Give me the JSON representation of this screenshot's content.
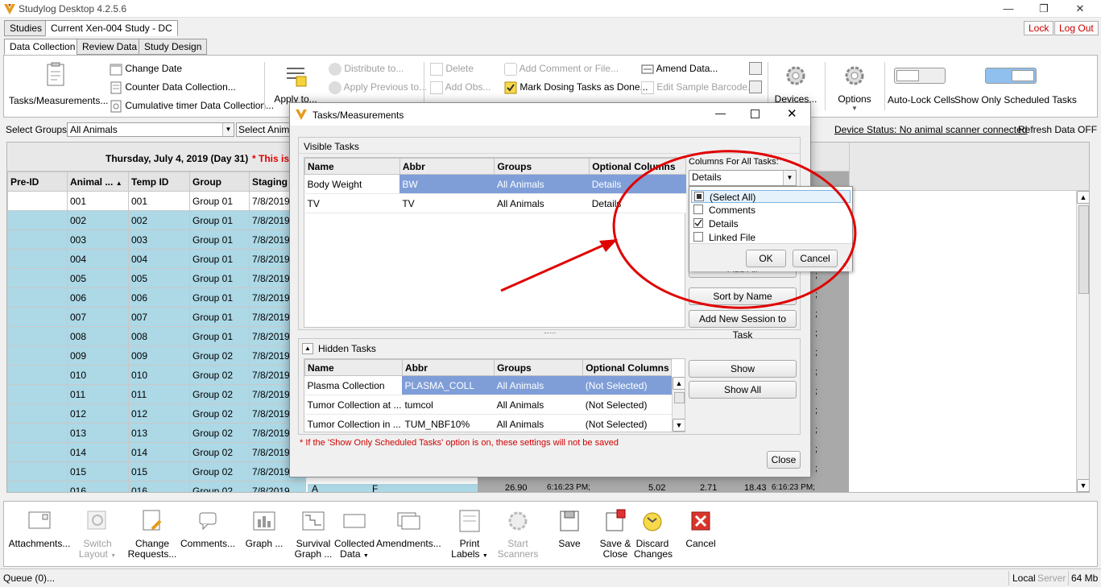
{
  "window": {
    "title": "Studylog Desktop 4.2.5.6"
  },
  "top_tabs": [
    "Studies",
    "Current Xen-004  Study  - DC"
  ],
  "lock_label": "Lock",
  "logout_label": "Log Out",
  "main_tabs": [
    "Data Collection",
    "Review Data",
    "Study Design"
  ],
  "ribbon": {
    "tasks": "Tasks/Measurements...",
    "change_date": "Change Date",
    "counter": "Counter Data Collection...",
    "cumulative": "Cumulative timer Data Collection...",
    "apply_to": "Apply to...",
    "distribute": "Distribute to...",
    "apply_previous": "Apply Previous to...",
    "delete": "Delete",
    "add_obs": "Add Obs...",
    "add_comment": "Add Comment or File...",
    "mark_dosing": "Mark Dosing Tasks as Done...",
    "edit_sample": "Edit Sample Barcode...",
    "amend_data": "Amend Data...",
    "devices": "Devices...",
    "options": "Options",
    "auto_lock": "Auto-Lock Cells",
    "show_scheduled": "Show Only Scheduled Tasks"
  },
  "filter": {
    "select_groups_label": "Select Groups:",
    "groups_value": "All Animals",
    "select_animals": "Select Animal",
    "device_status": "Device Status: No animal scanner connected",
    "refresh": "Refresh Data OFF"
  },
  "grid": {
    "date_header": "Thursday, July 4, 2019 (Day 31)",
    "warning_partial": "* This is",
    "columns": [
      "Pre-ID",
      "Animal ...",
      "Temp ID",
      "Group",
      "Staging"
    ],
    "rows": [
      [
        "",
        "001",
        "001",
        "Group 01",
        "7/8/2019"
      ],
      [
        "",
        "002",
        "002",
        "Group 01",
        "7/8/2019"
      ],
      [
        "",
        "003",
        "003",
        "Group 01",
        "7/8/2019"
      ],
      [
        "",
        "004",
        "004",
        "Group 01",
        "7/8/2019"
      ],
      [
        "",
        "005",
        "005",
        "Group 01",
        "7/8/2019"
      ],
      [
        "",
        "006",
        "006",
        "Group 01",
        "7/8/2019"
      ],
      [
        "",
        "007",
        "007",
        "Group 01",
        "7/8/2019"
      ],
      [
        "",
        "008",
        "008",
        "Group 01",
        "7/8/2019"
      ],
      [
        "",
        "009",
        "009",
        "Group 02",
        "7/8/2019"
      ],
      [
        "",
        "010",
        "010",
        "Group 02",
        "7/8/2019"
      ],
      [
        "",
        "011",
        "011",
        "Group 02",
        "7/8/2019"
      ],
      [
        "",
        "012",
        "012",
        "Group 02",
        "7/8/2019"
      ],
      [
        "",
        "013",
        "013",
        "Group 02",
        "7/8/2019"
      ],
      [
        "",
        "014",
        "014",
        "Group 02",
        "7/8/2019"
      ],
      [
        "",
        "015",
        "015",
        "Group 02",
        "7/8/2019"
      ],
      [
        "",
        "016",
        "016",
        "Group 02",
        "7/8/2019"
      ]
    ],
    "right_semis": [
      ";",
      ";",
      ";",
      ";",
      ";",
      ";",
      ";",
      ";",
      ";",
      ";",
      ";"
    ],
    "last_row_extra": {
      "a": "A",
      "f": "F",
      "v1": "26.90",
      "t1": "6:16:23 PM;",
      "v2": "5.02",
      "v3": "2.71",
      "v4": "18.43",
      "t2": "6:16:23 PM;"
    }
  },
  "dialog": {
    "title": "Tasks/Measurements",
    "visible_label": "Visible Tasks",
    "visible_columns": [
      "Name",
      "Abbr",
      "Groups",
      "Optional Columns"
    ],
    "visible_rows": [
      [
        "Body Weight",
        "BW",
        "All Animals",
        "Details"
      ],
      [
        "TV",
        "TV",
        "All Animals",
        "Details"
      ]
    ],
    "columns_for_all_label": "Columns For All Tasks:",
    "columns_value": "Details",
    "options": [
      {
        "label": "(Select All)",
        "state": "partial"
      },
      {
        "label": "Comments",
        "state": "unchecked"
      },
      {
        "label": "Details",
        "state": "checked"
      },
      {
        "label": "Linked File",
        "state": "unchecked"
      }
    ],
    "ok": "OK",
    "cancel": "Cancel",
    "hidden_add_all": "Add All",
    "sort_by_name": "Sort by Name",
    "add_session": "Add New Session to Task",
    "hidden_label": "Hidden Tasks",
    "hidden_columns": [
      "Name",
      "Abbr",
      "Groups",
      "Optional Columns"
    ],
    "hidden_rows": [
      [
        "Plasma Collection",
        "PLASMA_COLL",
        "All Animals",
        "(Not Selected)"
      ],
      [
        "Tumor Collection at ...",
        "tumcol",
        "All Animals",
        "(Not Selected)"
      ],
      [
        "Tumor Collection in ...",
        "TUM_NBF10%",
        "All Animals",
        "(Not Selected)"
      ]
    ],
    "show": "Show",
    "show_all": "Show All",
    "note": "* If the 'Show Only Scheduled Tasks' option is on, these settings will not be saved",
    "close": "Close"
  },
  "bottom": {
    "attachments": "Attachments...",
    "switch_layout": "Switch Layout",
    "change_requests": "Change Requests...",
    "comments": "Comments...",
    "graph": "Graph ...",
    "survival_graph": "Survival Graph ...",
    "collected_data": "Collected Data",
    "amendments": "Amendments...",
    "print_labels": "Print Labels",
    "start_scanners": "Start Scanners",
    "save": "Save",
    "save_close": "Save & Close",
    "discard": "Discard Changes",
    "cancel": "Cancel"
  },
  "status": {
    "queue": "Queue (0)...",
    "local": "Local",
    "server": "Server",
    "memory": "64 Mb"
  },
  "colors": {
    "accent_red": "#e00000",
    "highlight_blue": "#add8e6",
    "select_blue": "#7f9ed8"
  }
}
